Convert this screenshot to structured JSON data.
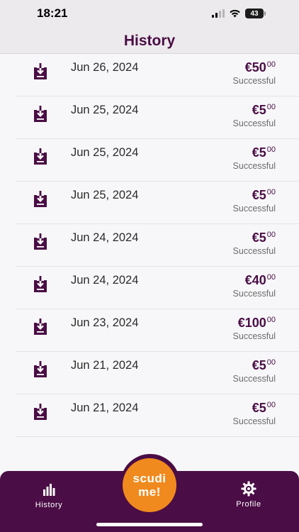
{
  "status_bar": {
    "time": "18:21",
    "battery": "43"
  },
  "header": {
    "title": "History"
  },
  "transactions": [
    {
      "date": "Jun 26, 2024",
      "amount_main": "€50",
      "amount_cents": "00",
      "status": "Successful"
    },
    {
      "date": "Jun 25, 2024",
      "amount_main": "€5",
      "amount_cents": "00",
      "status": "Successful"
    },
    {
      "date": "Jun 25, 2024",
      "amount_main": "€5",
      "amount_cents": "00",
      "status": "Successful"
    },
    {
      "date": "Jun 25, 2024",
      "amount_main": "€5",
      "amount_cents": "00",
      "status": "Successful"
    },
    {
      "date": "Jun 24, 2024",
      "amount_main": "€5",
      "amount_cents": "00",
      "status": "Successful"
    },
    {
      "date": "Jun 24, 2024",
      "amount_main": "€40",
      "amount_cents": "00",
      "status": "Successful"
    },
    {
      "date": "Jun 23, 2024",
      "amount_main": "€100",
      "amount_cents": "00",
      "status": "Successful"
    },
    {
      "date": "Jun 21, 2024",
      "amount_main": "€5",
      "amount_cents": "00",
      "status": "Successful"
    },
    {
      "date": "Jun 21, 2024",
      "amount_main": "€5",
      "amount_cents": "00",
      "status": "Successful"
    }
  ],
  "tabbar": {
    "history_label": "History",
    "profile_label": "Profile",
    "fab_line1": "scudi",
    "fab_line2": "me!"
  },
  "icons": {
    "row_icon": "download-icon",
    "history_tab_icon": "bar-chart-icon",
    "profile_tab_icon": "gear-icon"
  },
  "colors": {
    "brand": "#4a0d45",
    "accent": "#f08a1e",
    "background": "#f7f7f9"
  }
}
